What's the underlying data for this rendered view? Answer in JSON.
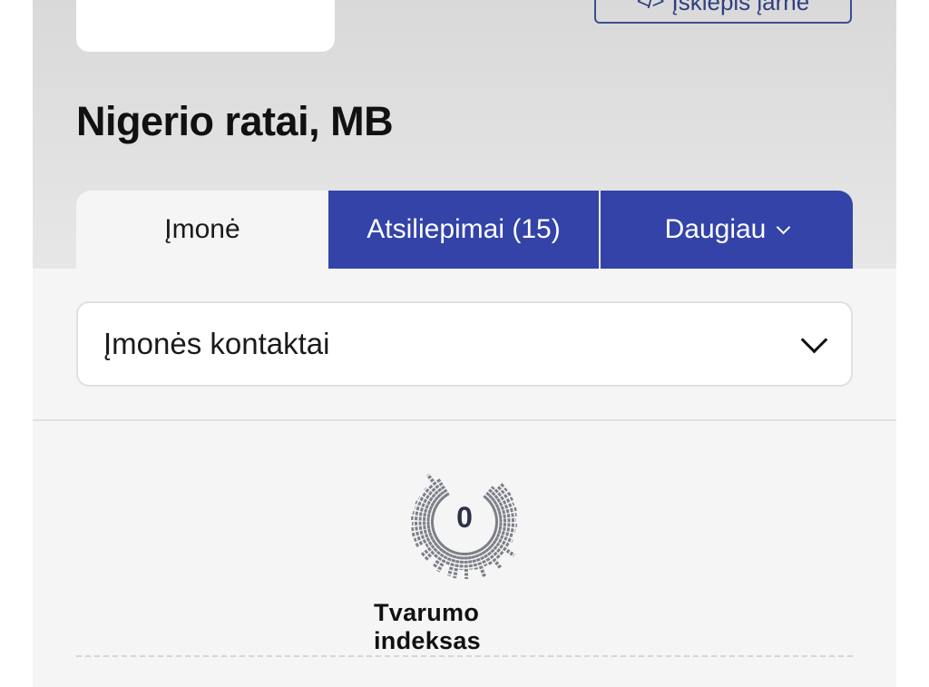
{
  "header": {
    "embed_button_icon": "code-icon",
    "embed_button_label": "Įskiepis įarne"
  },
  "company": {
    "name": "Nigerio ratai, MB"
  },
  "tabs": [
    {
      "label": "Įmonė",
      "active": true
    },
    {
      "label": "Atsiliepimai (15)",
      "active": false
    },
    {
      "label": "Daugiau",
      "active": false,
      "icon": "chevron-down-icon"
    }
  ],
  "contacts": {
    "label": "Įmonės kontaktai",
    "icon": "chevron-down-icon"
  },
  "sustainability": {
    "value": "0",
    "label": "Tvarumo indeksas"
  },
  "colors": {
    "brand_blue": "#3443a8",
    "hero_gray": "#dcdcdc",
    "page_bg": "#f5f5f5",
    "gauge_gray": "#7c7f87"
  }
}
